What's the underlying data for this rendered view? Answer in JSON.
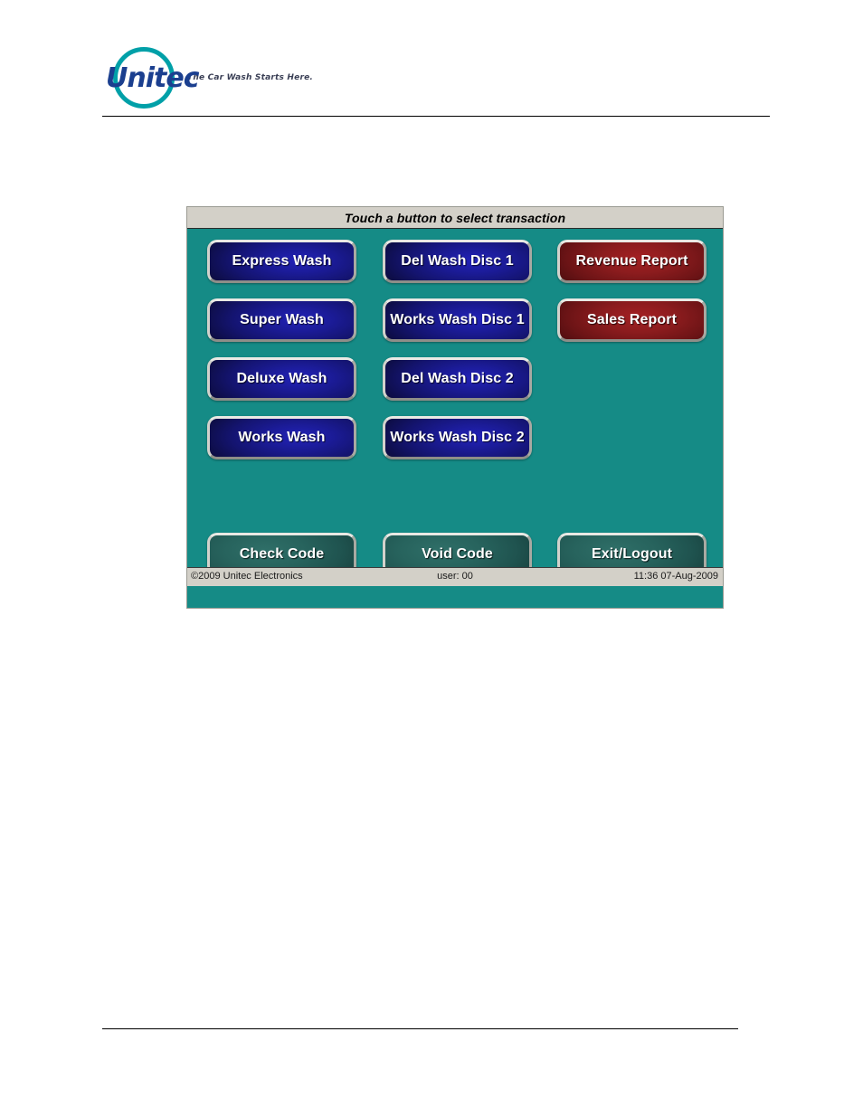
{
  "document": {
    "brand": {
      "name": "Unitec",
      "tagline": "The Car Wash Starts Here.",
      "ring_color": "#00a0a8",
      "wordmark_color": "#1b3f8f"
    }
  },
  "pos_screen": {
    "titlebar": {
      "text": "Touch a button to select transaction"
    },
    "background_color": "#158b86",
    "buttons": [
      {
        "label": "Express Wash",
        "style": "blue",
        "column": 1,
        "row": 1
      },
      {
        "label": "Super Wash",
        "style": "blue",
        "column": 1,
        "row": 2
      },
      {
        "label": "Deluxe Wash",
        "style": "blue",
        "column": 1,
        "row": 3
      },
      {
        "label": "Works Wash",
        "style": "blue",
        "column": 1,
        "row": 4
      },
      {
        "label": "Del Wash Disc 1",
        "style": "blue",
        "column": 2,
        "row": 1
      },
      {
        "label": "Works Wash Disc 1",
        "style": "blue",
        "column": 2,
        "row": 2
      },
      {
        "label": "Del Wash Disc 2",
        "style": "blue",
        "column": 2,
        "row": 3
      },
      {
        "label": "Works Wash Disc 2",
        "style": "blue",
        "column": 2,
        "row": 4
      },
      {
        "label": "Revenue Report",
        "style": "red",
        "column": 3,
        "row": 1
      },
      {
        "label": "Sales Report",
        "style": "red",
        "column": 3,
        "row": 2
      }
    ],
    "action_buttons": [
      {
        "label": "Check Code",
        "style": "teal",
        "column": 1
      },
      {
        "label": "Void Code",
        "style": "teal",
        "column": 2
      },
      {
        "label": "Exit/Logout",
        "style": "teal",
        "column": 3
      }
    ],
    "statusbar": {
      "copyright": "©2009 Unitec Electronics",
      "user": "user: 00",
      "timestamp": "11:36 07-Aug-2009"
    }
  }
}
